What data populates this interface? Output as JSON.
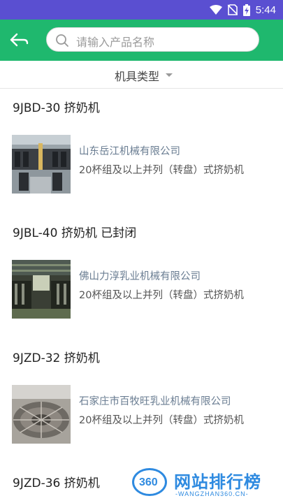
{
  "status_bar": {
    "time": "5:44",
    "icons": [
      "wifi-icon",
      "no-sim-icon",
      "battery-charging-icon"
    ],
    "background": "#5a4fd1"
  },
  "header": {
    "background": "#1fb86e",
    "back_icon": "back-arrow-icon",
    "search": {
      "placeholder": "请输入产品名称",
      "value": "",
      "icon": "search-icon"
    }
  },
  "filter": {
    "label": "机具类型",
    "icon": "caret-down-icon"
  },
  "items": [
    {
      "title": "9JBD-30 挤奶机",
      "company": "山东岳江机械有限公司",
      "category": "20杯组及以上并列（转盘）式挤奶机",
      "image": "milking-parlor-photo"
    },
    {
      "title": "9JBL-40 挤奶机 已封闭",
      "company": "佛山力淳乳业机械有限公司",
      "category": "20杯组及以上并列（转盘）式挤奶机",
      "image": "milking-line-photo"
    },
    {
      "title": "9JZD-32 挤奶机",
      "company": "石家庄市百牧旺乳业机械有限公司",
      "category": "20杯组及以上并列（转盘）式挤奶机",
      "image": "rotary-parlor-photo"
    },
    {
      "title": "9JZD-36 挤奶机"
    }
  ],
  "watermark": {
    "number": "360",
    "title": "网站排行榜",
    "subtitle": "-WANGZHAN360.CN-"
  }
}
